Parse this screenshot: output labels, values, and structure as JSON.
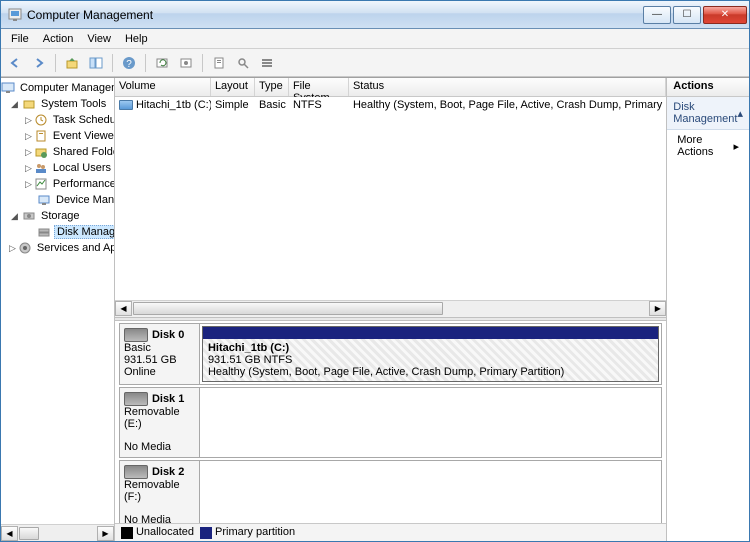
{
  "window": {
    "title": "Computer Management"
  },
  "menu": [
    "File",
    "Action",
    "View",
    "Help"
  ],
  "tree": {
    "root": "Computer Management (Local",
    "groups": [
      {
        "label": "System Tools",
        "children": [
          "Task Scheduler",
          "Event Viewer",
          "Shared Folders",
          "Local Users and Groups",
          "Performance",
          "Device Manager"
        ]
      },
      {
        "label": "Storage",
        "children": [
          "Disk Management"
        ]
      },
      {
        "label": "Services and Applications",
        "children": []
      }
    ]
  },
  "list": {
    "headers": [
      "Volume",
      "Layout",
      "Type",
      "File System",
      "Status"
    ],
    "row": {
      "volume": "Hitachi_1tb (C:)",
      "layout": "Simple",
      "type": "Basic",
      "fs": "NTFS",
      "status": "Healthy (System, Boot, Page File, Active, Crash Dump, Primary"
    }
  },
  "disks": [
    {
      "name": "Disk 0",
      "kind": "Basic",
      "size": "931.51 GB",
      "state": "Online",
      "part": {
        "name": "Hitachi_1tb  (C:)",
        "detail": "931.51 GB NTFS",
        "status": "Healthy (System, Boot, Page File, Active, Crash Dump, Primary Partition)"
      }
    },
    {
      "name": "Disk 1",
      "kind": "Removable (E:)",
      "size": "",
      "state": "No Media"
    },
    {
      "name": "Disk 2",
      "kind": "Removable (F:)",
      "size": "",
      "state": "No Media"
    }
  ],
  "legend": {
    "unalloc": "Unallocated",
    "primary": "Primary partition"
  },
  "actions": {
    "header": "Actions",
    "section": "Disk Management",
    "more": "More Actions"
  }
}
